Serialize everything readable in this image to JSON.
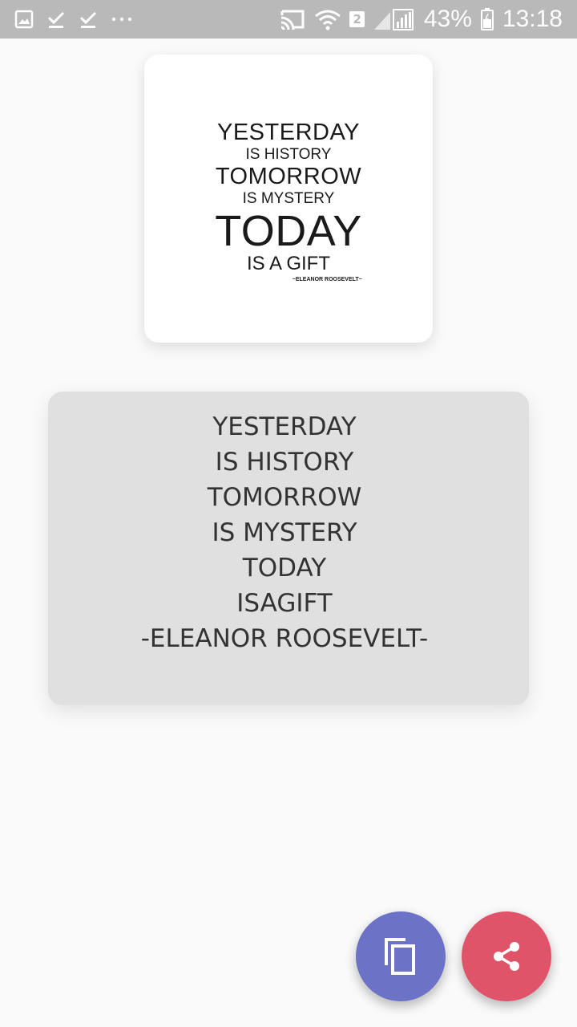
{
  "status_bar": {
    "battery_text": "43%",
    "time": "13:18",
    "sim_badge": "2",
    "left_icons": [
      "image-icon",
      "check-icon",
      "check-icon",
      "more-dots-icon"
    ],
    "right_icons": [
      "cast-icon",
      "wifi-icon",
      "signal-icon",
      "battery-icon"
    ]
  },
  "quote_image": {
    "line1": "YESTERDAY",
    "line2": "IS HISTORY",
    "line3": "TOMORROW",
    "line4": "IS MYSTERY",
    "line5": "TODAY",
    "line6": "IS A GIFT",
    "author": "~ELEANOR ROOSEVELT~"
  },
  "quote_text": {
    "lines": [
      "YESTERDAY",
      "IS HISTORY",
      "TOMORROW",
      "IS MYSTERY",
      "TODAY",
      "ISAGIFT",
      "-ELEANOR ROOSEVELT-"
    ]
  },
  "actions": {
    "copy_icon": "copy-icon",
    "share_icon": "share-icon"
  },
  "colors": {
    "status_bar": "#b9b9b9",
    "background": "#fafafa",
    "text_card": "#e0e0e0",
    "copy_fab": "#6c72c6",
    "share_fab": "#e0546a"
  }
}
